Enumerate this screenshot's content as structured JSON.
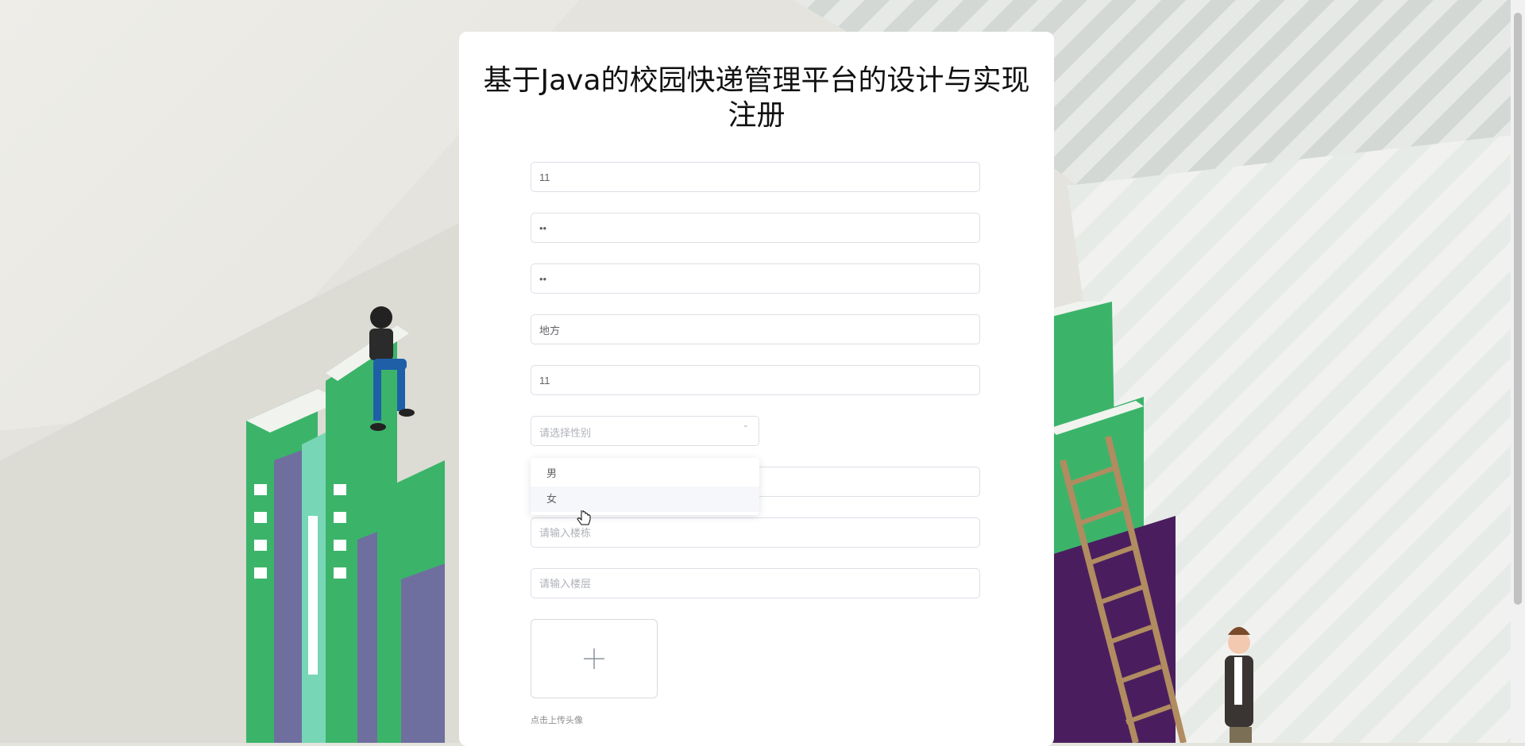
{
  "page": {
    "title_line1": "基于Java的校园快递管理平台的设计与实现",
    "title_line2": "注册"
  },
  "form": {
    "fields": [
      {
        "name": "field-1",
        "value": "11",
        "placeholder": ""
      },
      {
        "name": "field-2",
        "value": "••",
        "placeholder": ""
      },
      {
        "name": "field-3",
        "value": "••",
        "placeholder": ""
      },
      {
        "name": "field-4",
        "value": "地方",
        "placeholder": ""
      },
      {
        "name": "field-5",
        "value": "11",
        "placeholder": ""
      }
    ],
    "gender_select": {
      "placeholder": "请选择性别",
      "options": [
        "男",
        "女"
      ],
      "hovered": "女"
    },
    "building_input": {
      "placeholder": "请输入楼栋",
      "value": ""
    },
    "floor_input": {
      "placeholder": "请输入楼层",
      "value": ""
    },
    "upload": {
      "icon": "plus-icon",
      "hint": "点击上传头像"
    }
  },
  "colors": {
    "card_bg": "#ffffff",
    "input_border": "#dcdfe6",
    "placeholder": "#b0b3b9",
    "book_green": "#3bb46a",
    "book_purple": "#6e6f9e",
    "book_dark_purple": "#4a1e5e"
  }
}
